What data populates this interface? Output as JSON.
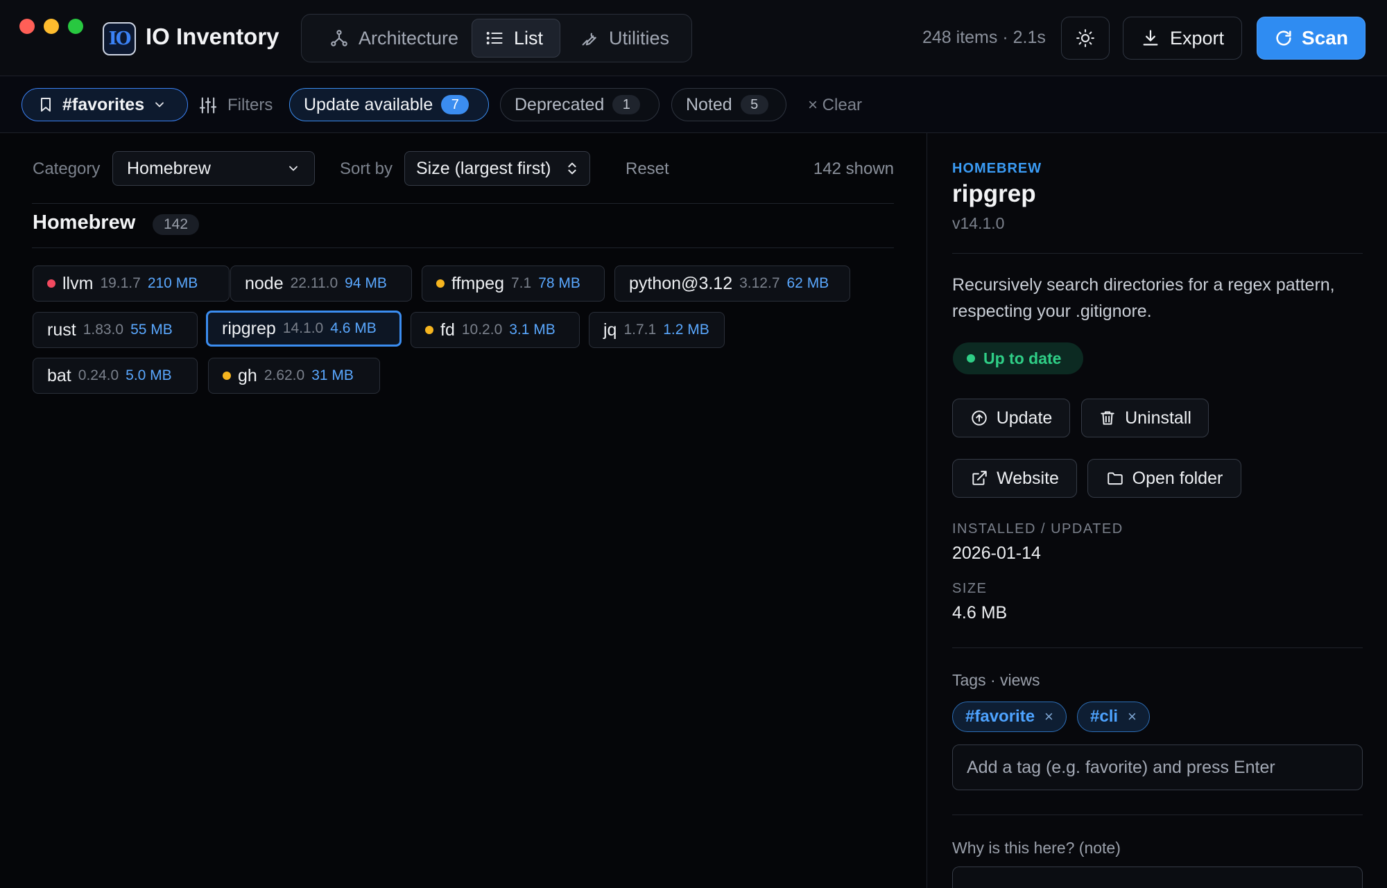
{
  "app": {
    "title": "IO Inventory",
    "logo_text": "IO"
  },
  "nav": {
    "tabs": [
      {
        "label": "Architecture"
      },
      {
        "label": "List"
      },
      {
        "label": "Utilities"
      }
    ]
  },
  "header": {
    "stats": "248 items · 2.1s",
    "export_label": "Export",
    "scan_label": "Scan"
  },
  "filters": {
    "view_label": "#favorites",
    "filters_label": "Filters",
    "update": {
      "label": "Update available",
      "count": "7"
    },
    "deprecated": {
      "label": "Deprecated",
      "count": "1"
    },
    "noted": {
      "label": "Noted",
      "count": "5"
    },
    "clear_label": "× Clear"
  },
  "controls": {
    "category_label": "Category",
    "category_value": "Homebrew",
    "sort_label": "Sort by",
    "sort_value": "Size (largest first)",
    "reset_label": "Reset",
    "shown": "142 shown"
  },
  "group": {
    "title": "Homebrew",
    "count": "142",
    "packages": [
      {
        "name": "llvm",
        "version": "19.1.7",
        "size": "210 MB",
        "status": "deprecated"
      },
      {
        "name": "node",
        "version": "22.11.0",
        "size": "94 MB",
        "status": ""
      },
      {
        "name": "ffmpeg",
        "version": "7.1",
        "size": "78 MB",
        "status": "update"
      },
      {
        "name": "python@3.12",
        "version": "3.12.7",
        "size": "62 MB",
        "status": ""
      },
      {
        "name": "rust",
        "version": "1.83.0",
        "size": "55 MB",
        "status": ""
      },
      {
        "name": "ripgrep",
        "version": "14.1.0",
        "size": "4.6 MB",
        "status": "selected"
      },
      {
        "name": "fd",
        "version": "10.2.0",
        "size": "3.1 MB",
        "status": "update"
      },
      {
        "name": "jq",
        "version": "1.7.1",
        "size": "1.2 MB",
        "status": ""
      },
      {
        "name": "bat",
        "version": "0.24.0",
        "size": "5.0 MB",
        "status": ""
      },
      {
        "name": "gh",
        "version": "2.62.0",
        "size": "31 MB",
        "status": "update"
      }
    ]
  },
  "detail": {
    "category": "HOMEBREW",
    "name": "ripgrep",
    "version": "v14.1.0",
    "description": "Recursively search directories for a regex pattern, respecting your .gitignore.",
    "status": "Up to date",
    "buttons": {
      "update": "Update",
      "uninstall": "Uninstall",
      "website": "Website",
      "open_folder": "Open folder"
    },
    "installed_label": "INSTALLED / UPDATED",
    "installed_value": "2026-01-14",
    "size_label": "SIZE",
    "size_value": "4.6 MB",
    "tags_label": "Tags · views",
    "tags": [
      {
        "label": "#favorite",
        "remove": "×"
      },
      {
        "label": "#cli",
        "remove": "×"
      }
    ],
    "tag_placeholder": "Add a tag (e.g. favorite) and press Enter",
    "note_label": "Why is this here? (note)"
  },
  "colors": {
    "accent": "#2f8cf2",
    "update_dot": "#f6b51f",
    "deprecated_dot": "#f2495f",
    "ok": "#2fce86"
  }
}
